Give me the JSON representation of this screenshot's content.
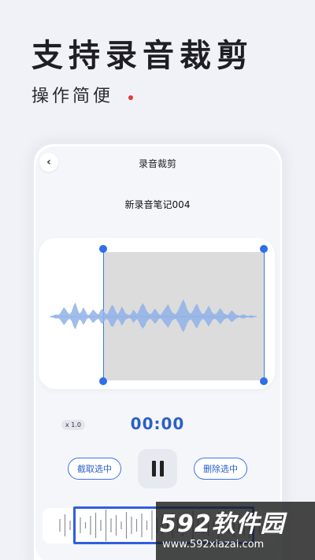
{
  "promo": {
    "headline": "支持录音裁剪",
    "subheadline": "操作简便"
  },
  "app": {
    "nav_title": "录音裁剪",
    "back_glyph": "‹",
    "recording_name": "新录音笔记004",
    "speed": "x 1.0",
    "time": "00:00",
    "crop_button": "截取选中",
    "delete_button": "删除选中",
    "playback_state": "playing"
  },
  "watermark": {
    "logo": "592软件园",
    "url": "www.592xiazai.com"
  },
  "colors": {
    "accent": "#2f6fe8",
    "waveform": "#8fb1e8",
    "selection": "#dcdcdc",
    "red_dot": "#e53935"
  }
}
